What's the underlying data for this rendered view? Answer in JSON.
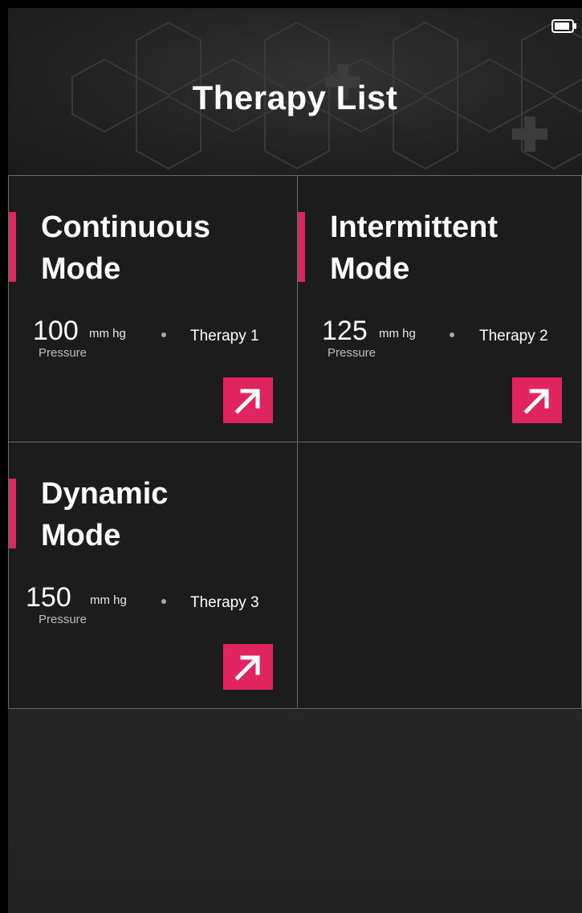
{
  "header": {
    "title": "Therapy List"
  },
  "status_bar": {
    "battery_icon": "battery-icon"
  },
  "colors": {
    "accent": "#e0245e",
    "background": "#1c1c1c",
    "text": "#ffffff"
  },
  "therapies": [
    {
      "mode_line1": "Continuous",
      "mode_line2": "Mode",
      "pressure_value": "100",
      "pressure_unit": "mm hg",
      "pressure_label": "Pressure",
      "therapy_name": "Therapy 1",
      "action_icon": "arrow-up-right-icon"
    },
    {
      "mode_line1": "Intermittent",
      "mode_line2": "Mode",
      "pressure_value": "125",
      "pressure_unit": "mm hg",
      "pressure_label": "Pressure",
      "therapy_name": "Therapy 2",
      "action_icon": "arrow-up-right-icon"
    },
    {
      "mode_line1": "Dynamic",
      "mode_line2": "Mode",
      "pressure_value": "150",
      "pressure_unit": "mm hg",
      "pressure_label": "Pressure",
      "therapy_name": "Therapy 3",
      "action_icon": "arrow-up-right-icon"
    }
  ]
}
